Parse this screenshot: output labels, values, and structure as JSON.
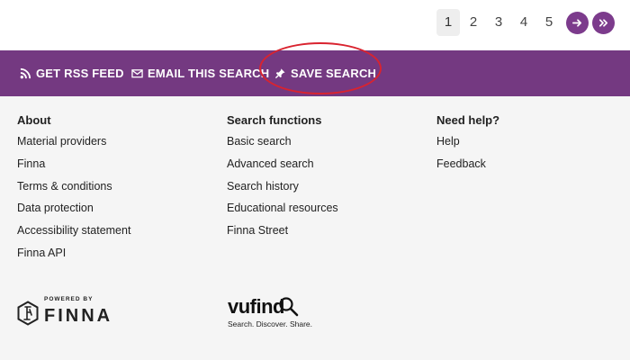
{
  "pagination": {
    "pages": [
      "1",
      "2",
      "3",
      "4",
      "5"
    ],
    "active_page": "1",
    "next_icon": "arrow-right-icon",
    "last_icon": "double-chevron-right-icon"
  },
  "actions": {
    "rss_label": "GET RSS FEED",
    "email_label": "EMAIL THIS SEARCH",
    "save_label": "SAVE SEARCH"
  },
  "footer": {
    "about": {
      "heading": "About",
      "links": [
        "Material providers",
        "Finna",
        "Terms & conditions",
        "Data protection",
        "Accessibility statement",
        "Finna API"
      ]
    },
    "search_functions": {
      "heading": "Search functions",
      "links": [
        "Basic search",
        "Advanced search",
        "Search history",
        "Educational resources",
        "Finna Street"
      ]
    },
    "help": {
      "heading": "Need help?",
      "links": [
        "Help",
        "Feedback"
      ]
    }
  },
  "logos": {
    "finna_powered": "POWERED BY",
    "finna_wordmark": "FINNA",
    "vufind_wordmark": "vufind",
    "vufind_tagline": "Search. Discover. Share."
  },
  "colors": {
    "brand_purple": "#743981",
    "highlight_red": "#d9232f"
  }
}
